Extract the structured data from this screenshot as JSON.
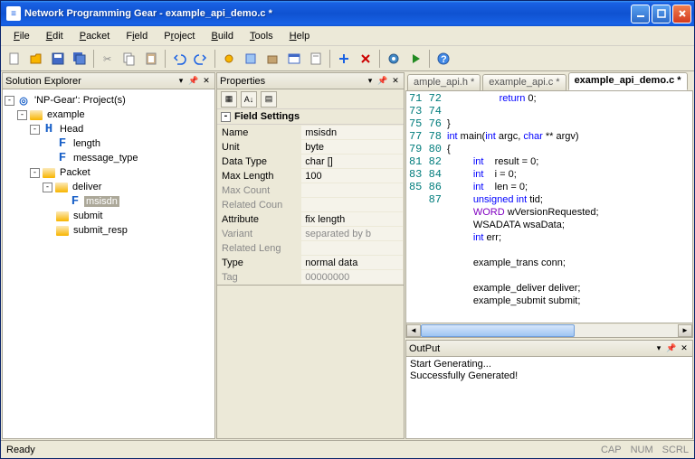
{
  "window": {
    "title": "Network Programming Gear - example_api_demo.c *"
  },
  "menu": [
    "File",
    "Edit",
    "Packet",
    "Field",
    "Project",
    "Build",
    "Tools",
    "Help"
  ],
  "panes": {
    "explorer_title": "Solution Explorer",
    "properties_title": "Properties",
    "output_title": "OutPut"
  },
  "tree": {
    "root": "'NP-Gear': Project(s)",
    "example": "example",
    "head": "Head",
    "length": "length",
    "message_type": "message_type",
    "packet": "Packet",
    "deliver": "deliver",
    "msisdn": "msisdn",
    "submit": "submit",
    "submit_resp": "submit_resp"
  },
  "props": {
    "section": "Field Settings",
    "rows": {
      "name_k": "Name",
      "name_v": "msisdn",
      "unit_k": "Unit",
      "unit_v": "byte",
      "datatype_k": "Data Type",
      "datatype_v": "char []",
      "maxlen_k": "Max Length",
      "maxlen_v": "100",
      "maxcount_k": "Max Count",
      "maxcount_v": "",
      "relcount_k": "Related Coun",
      "relcount_v": "",
      "attr_k": "Attribute",
      "attr_v": "fix length",
      "variant_k": "Variant",
      "variant_v": "separated by b",
      "rellen_k": "Related Leng",
      "rellen_v": "",
      "type_k": "Type",
      "type_v": "normal data",
      "tag_k": "Tag",
      "tag_v": "00000000"
    }
  },
  "tabs": {
    "t1": "ample_api.h *",
    "t2": "example_api.c *",
    "t3": "example_api_demo.c *"
  },
  "code": {
    "lines": [
      "71",
      "72",
      "73",
      "74",
      "75",
      "76",
      "77",
      "78",
      "79",
      "80",
      "81",
      "82",
      "83",
      "84",
      "85",
      "86",
      "87"
    ],
    "l71a": "return",
    "l71b": " 0;",
    "l73": "}",
    "l74_int": "int",
    "l74_main": " main(",
    "l74_int2": "int",
    "l74_argc": " argc, ",
    "l74_char": "char",
    "l74_rest": " ** argv)",
    "l75": "{",
    "l76_int": "int",
    "l76_rest": "    result = 0;",
    "l77_int": "int",
    "l77_rest": "    i = 0;",
    "l78_int": "int",
    "l78_rest": "    len = 0;",
    "l79_a": "unsigned",
    "l79_b": " int",
    "l79_c": " tid;",
    "l80_a": "WORD",
    "l80_b": " wVersionRequested;",
    "l81": "WSADATA wsaData;",
    "l82_a": "int",
    "l82_b": " err;",
    "l84": "example_trans conn;",
    "l86": "example_deliver deliver;",
    "l87": "example_submit submit;"
  },
  "output": {
    "line1": "Start Generating...",
    "line2": "Successfully Generated!"
  },
  "status": {
    "left": "Ready",
    "cap": "CAP",
    "num": "NUM",
    "scrl": "SCRL"
  }
}
